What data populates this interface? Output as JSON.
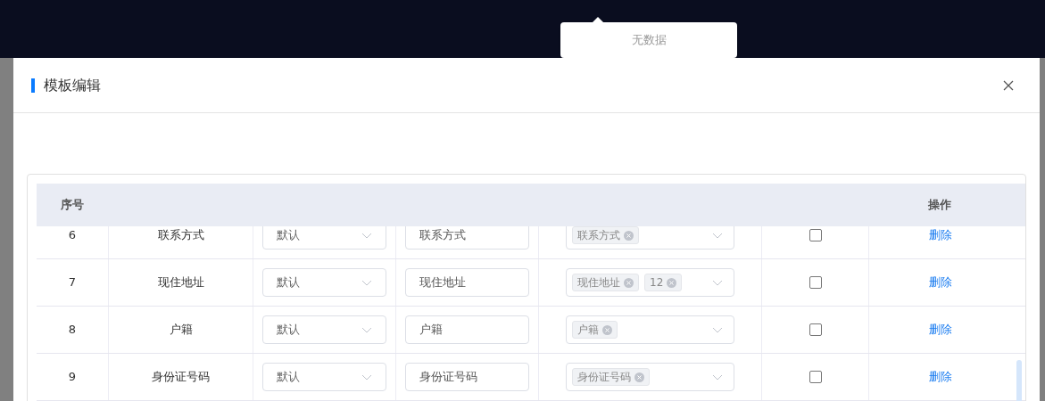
{
  "popover": {
    "text": "无数据"
  },
  "dialog": {
    "title": "模板编辑"
  },
  "table": {
    "header": {
      "index_label": "序号",
      "action_label": "操作"
    },
    "rows": [
      {
        "index": "6",
        "name": "联系方式",
        "type": "默认",
        "alias": "联系方式",
        "tags": [
          "联系方式"
        ],
        "checked": false,
        "action": "删除"
      },
      {
        "index": "7",
        "name": "现住地址",
        "type": "默认",
        "alias": "现住地址",
        "tags": [
          "现住地址",
          "12"
        ],
        "checked": false,
        "action": "删除"
      },
      {
        "index": "8",
        "name": "户籍",
        "type": "默认",
        "alias": "户籍",
        "tags": [
          "户籍"
        ],
        "checked": false,
        "action": "删除"
      },
      {
        "index": "9",
        "name": "身份证号码",
        "type": "默认",
        "alias": "身份证号码",
        "tags": [
          "身份证号码"
        ],
        "checked": false,
        "action": "删除"
      }
    ]
  }
}
